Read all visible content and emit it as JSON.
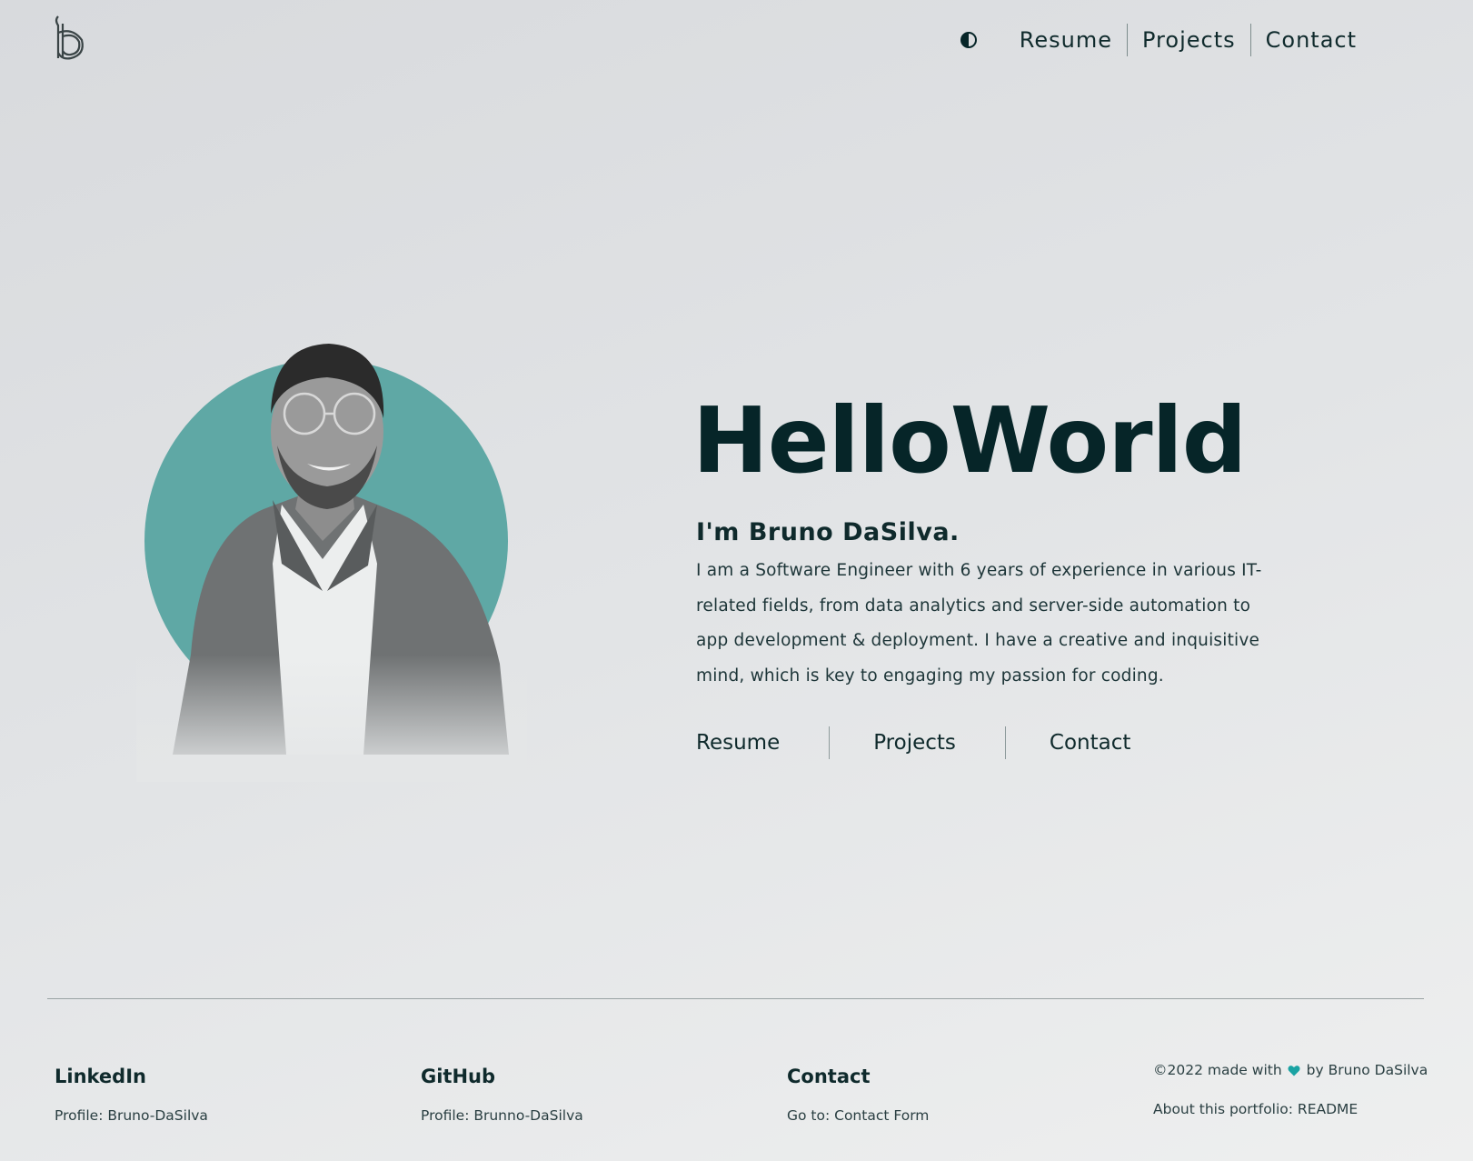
{
  "header": {
    "logo_icon": "b-monogram-logo",
    "theme_toggle_icon": "half-circle-contrast-icon",
    "nav": [
      {
        "label": "Resume"
      },
      {
        "label": "Projects"
      },
      {
        "label": "Contact"
      }
    ]
  },
  "hero": {
    "heading": "HelloWorld",
    "intro": "I'm Bruno DaSilva.",
    "bio": "I am a Software Engineer with 6 years of experience in various IT-related fields, from data analytics and server-side automation to app development & deployment. I have a creative and inquisitive mind, which is key to engaging my passion for coding.",
    "links": [
      {
        "label": "Resume"
      },
      {
        "label": "Projects"
      },
      {
        "label": "Contact"
      }
    ],
    "portrait_accent_color": "#5fa8a5"
  },
  "footer": {
    "columns": [
      {
        "title": "LinkedIn",
        "link": "Profile: Bruno-DaSilva"
      },
      {
        "title": "GitHub",
        "link": "Profile: Brunno-DaSilva"
      },
      {
        "title": "Contact",
        "link": "Go to: Contact Form"
      }
    ],
    "credit_prefix": "©2022 made with",
    "credit_suffix": "by Bruno DaSilva",
    "heart_icon": "heart-icon",
    "heart_color": "#1aa3a3",
    "readme": "About this portfolio: README"
  }
}
